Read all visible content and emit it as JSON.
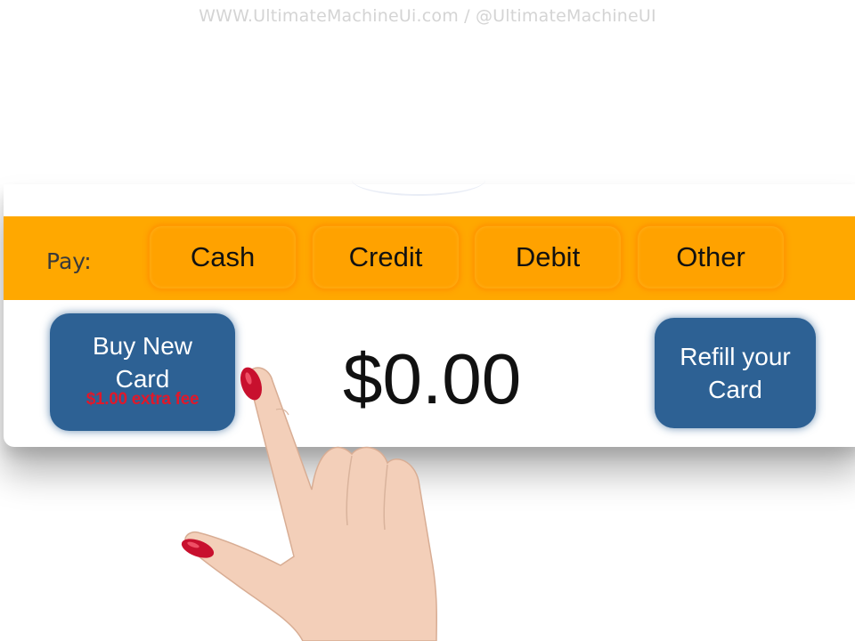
{
  "watermark": "WWW.UltimateMachineUi.com / @UltimateMachineUI",
  "pay_bar": {
    "label": "Pay:",
    "options": [
      "Cash",
      "Credit",
      "Debit",
      "Other"
    ]
  },
  "buy_new_card": {
    "line1": "Buy New",
    "line2": "Card",
    "fee": "$1.00 extra fee"
  },
  "amount": "$0.00",
  "refill_card": {
    "line1": "Refill your",
    "line2": "Card"
  },
  "colors": {
    "pay_bar": "#ffa800",
    "pay_button": "#ffa200",
    "blue_button": "#2d6194",
    "fee_text": "#e0182a",
    "nail_polish": "#c8102e"
  },
  "icons": [
    "pointing-hand"
  ]
}
